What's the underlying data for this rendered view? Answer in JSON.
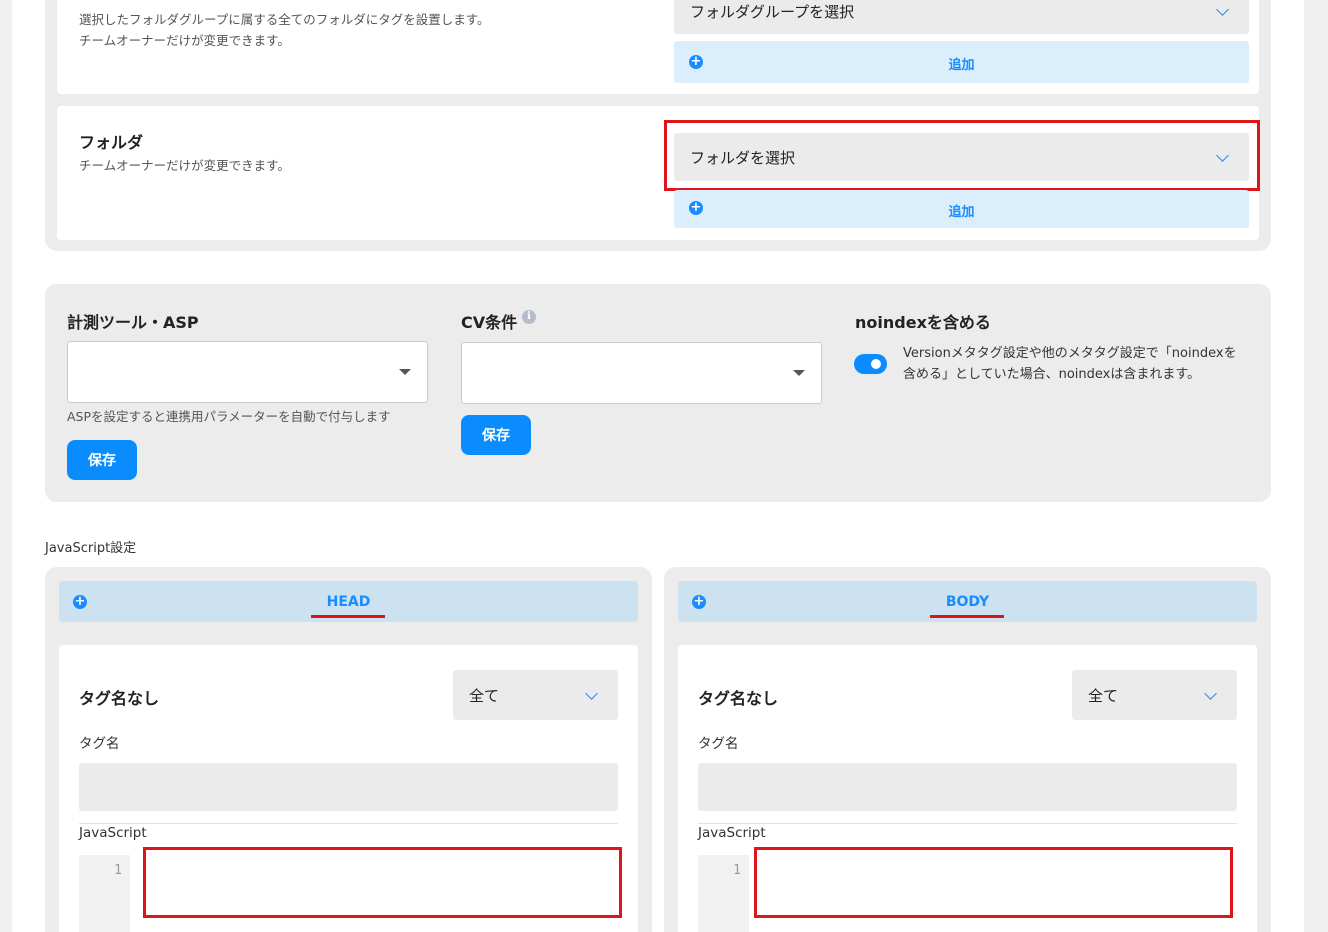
{
  "folder_group": {
    "description_lines": [
      "選択したフォルダグループに属する全てのフォルダにタグを設置します。",
      "チームオーナーだけが変更できます。"
    ],
    "select_value": "フォルダグループを選択",
    "add_label": "追加"
  },
  "folder": {
    "title": "フォルダ",
    "description": "チームオーナーだけが変更できます。",
    "select_value": "フォルダを選択",
    "add_label": "追加"
  },
  "measurement": {
    "tool_title": "計測ツール・ASP",
    "tool_value": "",
    "tool_help": "ASPを設定すると連携用パラメーターを自動で付与します",
    "tool_save": "保存",
    "cv_title": "CV条件",
    "cv_info_icon": "info-icon",
    "cv_value": "",
    "cv_save": "保存",
    "noindex_title": "noindexを含める",
    "noindex_enabled": true,
    "noindex_desc_lines": [
      "Versionメタタグ設定や他のメタタグ設定で「noindexを",
      "含める」としていた場合、noindexは含まれます。"
    ]
  },
  "javascript": {
    "section_label": "JavaScript設定",
    "panels": [
      {
        "header": "HEAD",
        "tag_title": "タグ名なし",
        "filter_value": "全て",
        "tag_name_label": "タグ名",
        "tag_name_value": "",
        "code_label": "JavaScript",
        "line_number": "1"
      },
      {
        "header": "BODY",
        "tag_title": "タグ名なし",
        "filter_value": "全て",
        "tag_name_label": "タグ名",
        "tag_name_value": "",
        "code_label": "JavaScript",
        "line_number": "1"
      }
    ]
  },
  "colors": {
    "accent": "#1a8cff",
    "button": "#0a8cff",
    "highlight": "#e0151b",
    "add_bar": "#dbeefc",
    "js_header": "#cde2f1"
  }
}
